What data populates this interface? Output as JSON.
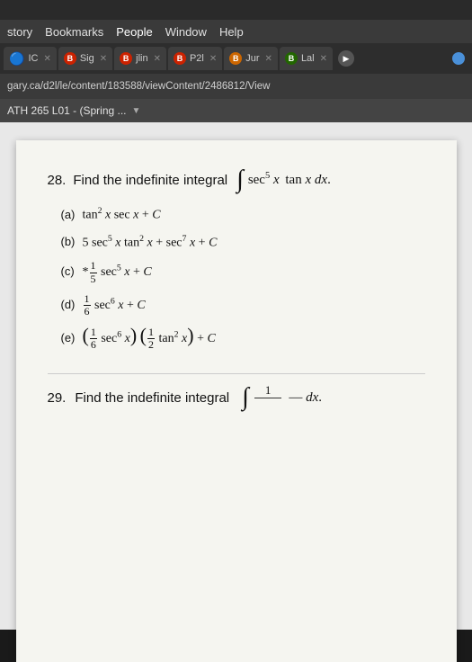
{
  "topBar": {
    "label": ""
  },
  "menuBar": {
    "items": [
      "story",
      "Bookmarks",
      "People",
      "Window",
      "Help"
    ]
  },
  "tabs": [
    {
      "id": "tab1",
      "icon": "🔵",
      "iconClass": "",
      "label": "IC",
      "close": true,
      "type": "text"
    },
    {
      "id": "tab2",
      "icon": "B",
      "iconClass": "b-red",
      "label": "Sig",
      "close": true
    },
    {
      "id": "tab3",
      "icon": "B",
      "iconClass": "b-red",
      "label": "jlin",
      "close": true
    },
    {
      "id": "tab4",
      "icon": "B",
      "iconClass": "b-red",
      "label": "P2l",
      "close": true
    },
    {
      "id": "tab5",
      "icon": "B",
      "iconClass": "b-orange",
      "label": "Jur",
      "close": true
    },
    {
      "id": "tab6",
      "icon": "B",
      "iconClass": "b-green",
      "label": "Lal",
      "close": true
    },
    {
      "id": "tab7",
      "label": "▶",
      "type": "play"
    }
  ],
  "addressBar": {
    "url": "gary.ca/d2l/le/content/183588/viewContent/2486812/View"
  },
  "breadcrumb": {
    "text": "ATH 265 L01 - (Spring ...",
    "hasDropdown": true
  },
  "question28": {
    "number": "28.",
    "text": "Find the indefinite integral",
    "integral": "∫ sec⁵ x  tan x dx.",
    "options": [
      {
        "label": "(a)",
        "text": "tan² x sec x + C",
        "correct": false
      },
      {
        "label": "(b)",
        "text": "5 sec⁵ x tan² x + sec⁷ x + C",
        "correct": false
      },
      {
        "label": "(c)",
        "text": "* ¹/₅ sec⁵ x + C",
        "correct": true
      },
      {
        "label": "(d)",
        "text": "¹/₆ sec⁶ x + C",
        "correct": false
      },
      {
        "label": "(e)",
        "text": "(¹/₆ sec⁶ x)(¹/₂ tan² x) + C",
        "correct": false
      }
    ]
  },
  "question29": {
    "number": "29.",
    "text": "Find the indefinite integral",
    "fraction": {
      "num": "1",
      "den": ""
    },
    "suffix": "dx."
  }
}
